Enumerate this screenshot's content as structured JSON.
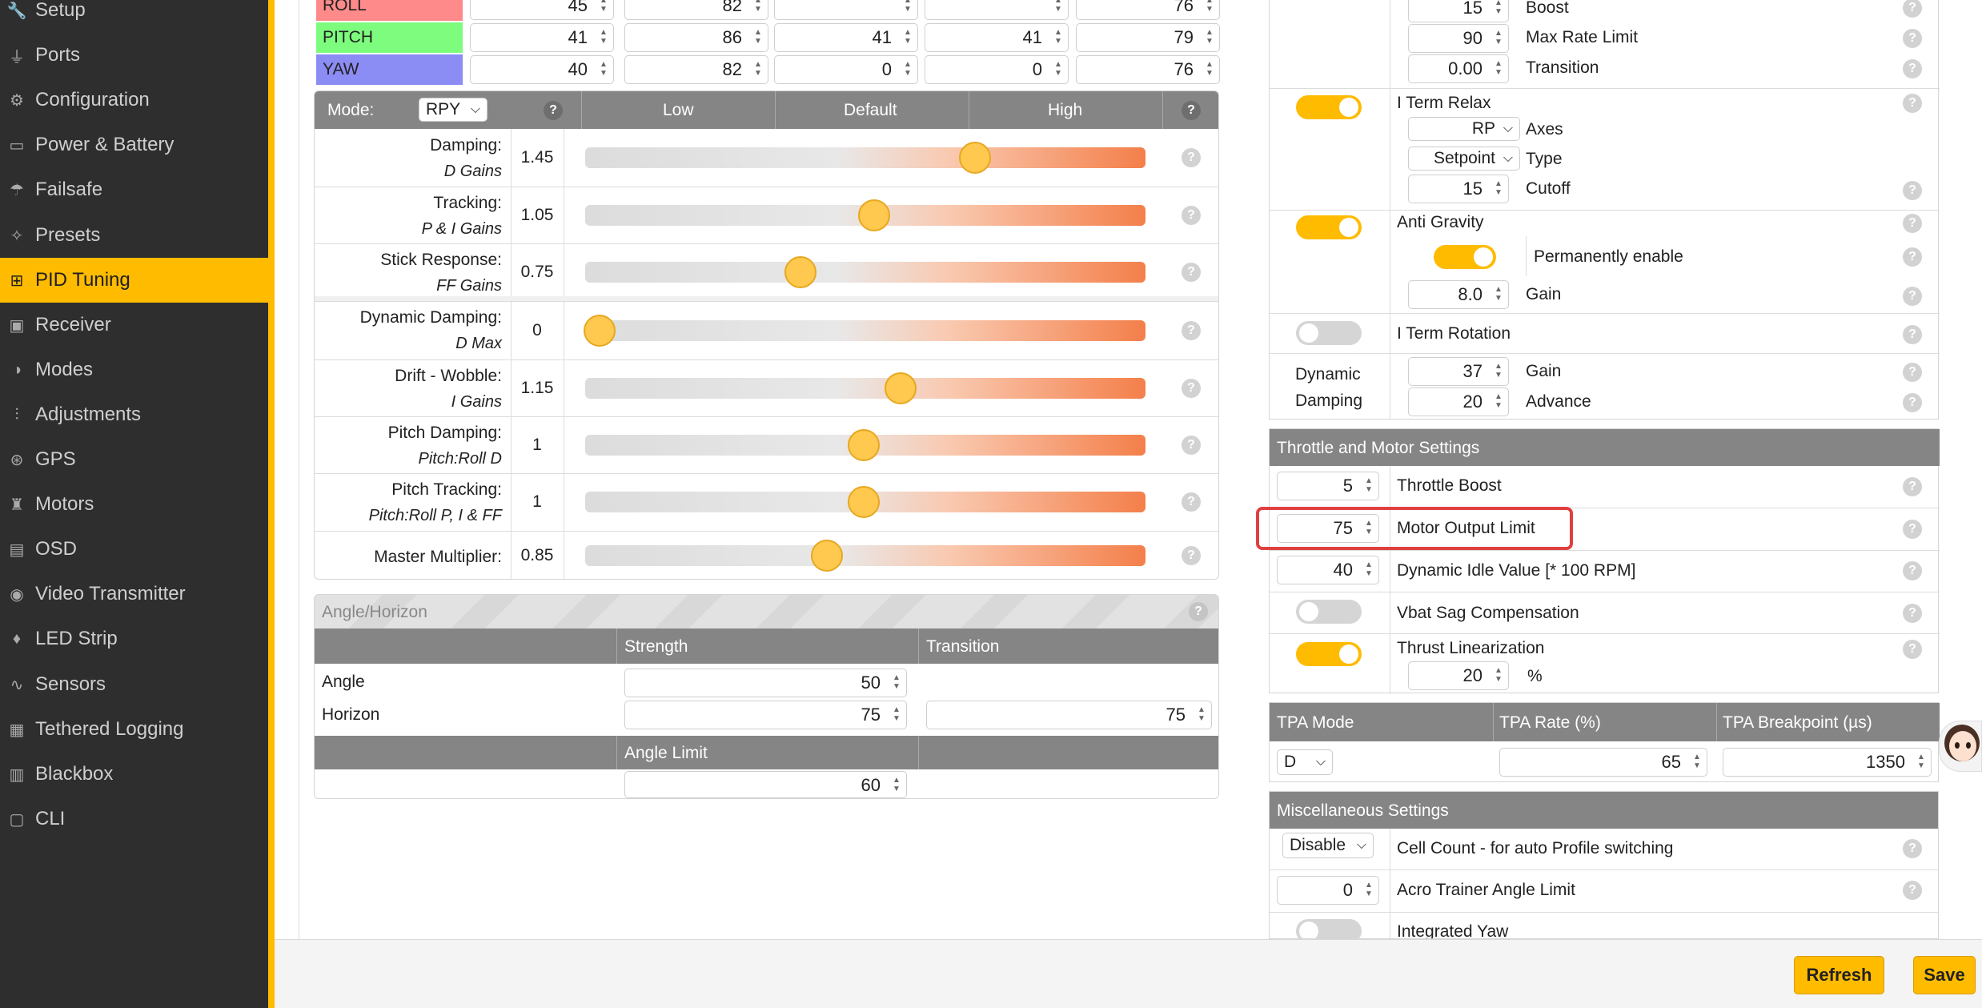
{
  "sidebar": {
    "items": [
      {
        "label": "Setup",
        "icon": "wrench-icon"
      },
      {
        "label": "Ports",
        "icon": "plug-icon"
      },
      {
        "label": "Configuration",
        "icon": "gear-icon"
      },
      {
        "label": "Power & Battery",
        "icon": "battery-icon"
      },
      {
        "label": "Failsafe",
        "icon": "parachute-icon"
      },
      {
        "label": "Presets",
        "icon": "wand-icon"
      },
      {
        "label": "PID Tuning",
        "icon": "sitemap-icon"
      },
      {
        "label": "Receiver",
        "icon": "radio-icon"
      },
      {
        "label": "Modes",
        "icon": "toggle-icon"
      },
      {
        "label": "Adjustments",
        "icon": "sliders-icon"
      },
      {
        "label": "GPS",
        "icon": "satellite-icon"
      },
      {
        "label": "Motors",
        "icon": "motor-icon"
      },
      {
        "label": "OSD",
        "icon": "osd-icon"
      },
      {
        "label": "Video Transmitter",
        "icon": "broadcast-icon"
      },
      {
        "label": "LED Strip",
        "icon": "bulb-icon"
      },
      {
        "label": "Sensors",
        "icon": "pulse-icon"
      },
      {
        "label": "Tethered Logging",
        "icon": "log-icon"
      },
      {
        "label": "Blackbox",
        "icon": "blackbox-icon"
      },
      {
        "label": "CLI",
        "icon": "terminal-icon"
      }
    ],
    "active": "PID Tuning",
    "accent": "#ffbb00"
  },
  "pid_table": {
    "rows": [
      {
        "name": "ROLL",
        "color": "#ff8a8a",
        "values": [
          "45",
          "82",
          "",
          "",
          "76"
        ]
      },
      {
        "name": "PITCH",
        "color": "#7dfc7d",
        "values": [
          "41",
          "86",
          "41",
          "41",
          "79"
        ]
      },
      {
        "name": "YAW",
        "color": "#8c8cf5",
        "values": [
          "40",
          "82",
          "0",
          "0",
          "76"
        ]
      }
    ]
  },
  "sliders": {
    "mode_label": "Mode:",
    "mode_value": "RPY",
    "col_low": "Low",
    "col_default": "Default",
    "col_high": "High",
    "rows": [
      {
        "label": "Damping:",
        "sub": "D Gains",
        "value": "1.45",
        "level": 0.71
      },
      {
        "label": "Tracking:",
        "sub": "P & I Gains",
        "value": "1.05",
        "level": 0.52
      },
      {
        "label": "Stick Response:",
        "sub": "FF Gains",
        "value": "0.75",
        "level": 0.38
      },
      {
        "label": "Dynamic Damping:",
        "sub": "D Max",
        "value": "0",
        "level": 0.0
      },
      {
        "label": "Drift - Wobble:",
        "sub": "I Gains",
        "value": "1.15",
        "level": 0.57
      },
      {
        "label": "Pitch Damping:",
        "sub": "Pitch:Roll D",
        "value": "1",
        "level": 0.5
      },
      {
        "label": "Pitch Tracking:",
        "sub": "Pitch:Roll P, I & FF",
        "value": "1",
        "level": 0.5
      },
      {
        "label": "Master Multiplier:",
        "sub": "",
        "value": "0.85",
        "level": 0.43
      }
    ]
  },
  "angle_horizon": {
    "title": "Angle/Horizon",
    "col_strength": "Strength",
    "col_transition": "Transition",
    "angle_label": "Angle",
    "angle_strength": "50",
    "horizon_label": "Horizon",
    "horizon_strength": "75",
    "horizon_transition": "75",
    "angle_limit_label": "Angle Limit",
    "angle_limit": "60"
  },
  "right_top": {
    "boost_value": "15",
    "boost_label": "Boost",
    "max_rate_value": "90",
    "max_rate_label": "Max Rate Limit",
    "transition_value": "0.00",
    "transition_label": "Transition",
    "iterm_relax_label": "I Term Relax",
    "axes_value": "RP",
    "axes_label": "Axes",
    "type_value": "Setpoint",
    "type_label": "Type",
    "cutoff_value": "15",
    "cutoff_label": "Cutoff",
    "anti_gravity_label": "Anti Gravity",
    "perm_enable_label": "Permanently enable",
    "ag_gain_value": "8.0",
    "ag_gain_label": "Gain",
    "iterm_rotation_label": "I Term Rotation",
    "dyn_damping_label_1": "Dynamic",
    "dyn_damping_label_2": "Damping",
    "dd_gain_value": "37",
    "dd_gain_label": "Gain",
    "dd_advance_value": "20",
    "dd_advance_label": "Advance"
  },
  "throttle": {
    "title": "Throttle and Motor Settings",
    "throttle_boost_value": "5",
    "throttle_boost_label": "Throttle Boost",
    "motor_output_value": "75",
    "motor_output_label": "Motor Output Limit",
    "idle_value": "40",
    "idle_label": "Dynamic Idle Value [* 100 RPM]",
    "vbat_label": "Vbat Sag Compensation",
    "thrust_label": "Thrust Linearization",
    "thrust_value": "20",
    "thrust_unit": "%"
  },
  "tpa": {
    "mode_label": "TPA Mode",
    "rate_label": "TPA Rate (%)",
    "breakpoint_label": "TPA Breakpoint (µs)",
    "mode_value": "D",
    "rate_value": "65",
    "breakpoint_value": "1350"
  },
  "misc": {
    "title": "Miscellaneous Settings",
    "cell_value": "Disable",
    "cell_label": "Cell Count - for auto Profile switching",
    "acro_value": "0",
    "acro_label": "Acro Trainer Angle Limit",
    "yaw_label": "Integrated Yaw"
  },
  "footer": {
    "refresh": "Refresh",
    "save": "Save"
  },
  "highlight_color": "#e04040"
}
